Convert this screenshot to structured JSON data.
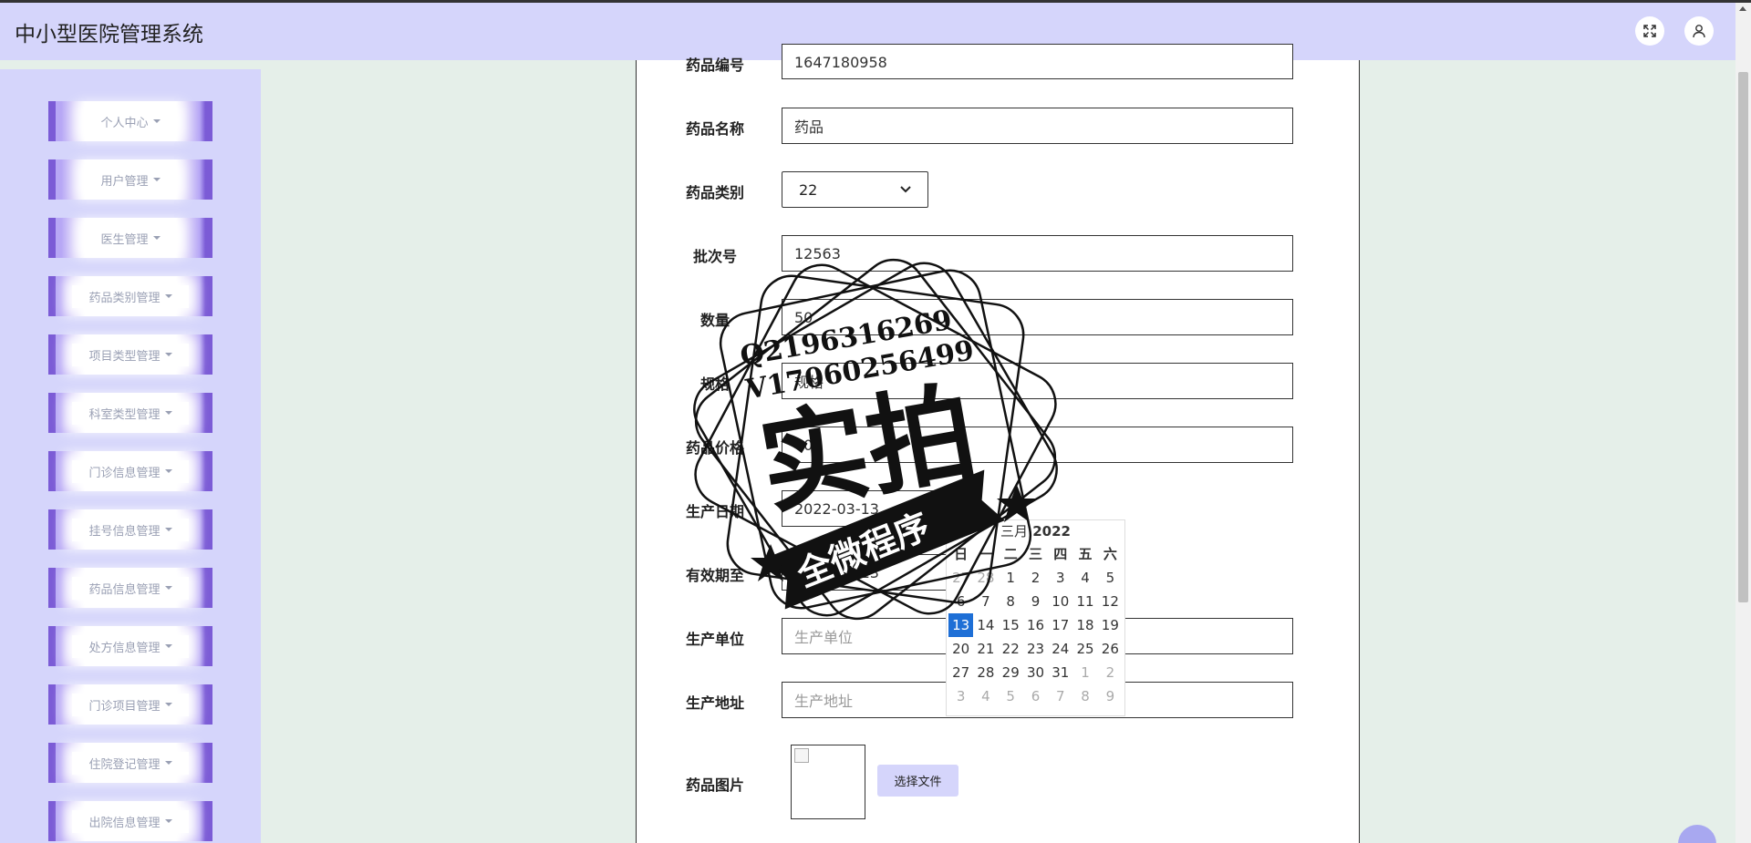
{
  "app": {
    "title": "中小型医院管理系统"
  },
  "header": {
    "fullscreen_icon": "expand-icon",
    "user_icon": "user-icon"
  },
  "sidebar": {
    "items": [
      {
        "label": "个人中心"
      },
      {
        "label": "用户管理"
      },
      {
        "label": "医生管理"
      },
      {
        "label": "药品类别管理"
      },
      {
        "label": "项目类型管理"
      },
      {
        "label": "科室类型管理"
      },
      {
        "label": "门诊信息管理"
      },
      {
        "label": "挂号信息管理"
      },
      {
        "label": "药品信息管理"
      },
      {
        "label": "处方信息管理"
      },
      {
        "label": "门诊项目管理"
      },
      {
        "label": "住院登记管理"
      },
      {
        "label": "出院信息管理"
      }
    ]
  },
  "form": {
    "drug_code": {
      "label": "药品编号",
      "value": "1647180958"
    },
    "drug_name": {
      "label": "药品名称",
      "value": "药品"
    },
    "drug_category": {
      "label": "药品类别",
      "value": "22"
    },
    "batch_no": {
      "label": "批次号",
      "value": "12563"
    },
    "quantity": {
      "label": "数量",
      "value": "50"
    },
    "spec": {
      "label": "规格",
      "value": "规格"
    },
    "price": {
      "label": "药品价格",
      "value": "60"
    },
    "production_date": {
      "label": "生产日期",
      "value": "2022-03-13"
    },
    "expiry_date": {
      "label": "有效期至",
      "value": "2022-03-13"
    },
    "manufacturer": {
      "label": "生产单位",
      "placeholder": "生产单位"
    },
    "manufacturer_address": {
      "label": "生产地址",
      "placeholder": "生产地址"
    },
    "drug_image": {
      "label": "药品图片",
      "button_label": "选择文件"
    }
  },
  "calendar": {
    "month": "三月",
    "year": "2022",
    "weekdays": [
      "日",
      "一",
      "二",
      "三",
      "四",
      "五",
      "六"
    ],
    "days": [
      [
        "27",
        "28",
        "1",
        "2",
        "3",
        "4",
        "5"
      ],
      [
        "6",
        "7",
        "8",
        "9",
        "10",
        "11",
        "12"
      ],
      [
        "13",
        "14",
        "15",
        "16",
        "17",
        "18",
        "19"
      ],
      [
        "20",
        "21",
        "22",
        "23",
        "24",
        "25",
        "26"
      ],
      [
        "27",
        "28",
        "29",
        "30",
        "31",
        "1",
        "2"
      ],
      [
        "3",
        "4",
        "5",
        "6",
        "7",
        "8",
        "9"
      ]
    ],
    "selected_day": "13"
  },
  "watermark": {
    "line1": "Q2196316269",
    "line2": "V17060256499",
    "main": "实拍",
    "banner": "全微程序"
  }
}
